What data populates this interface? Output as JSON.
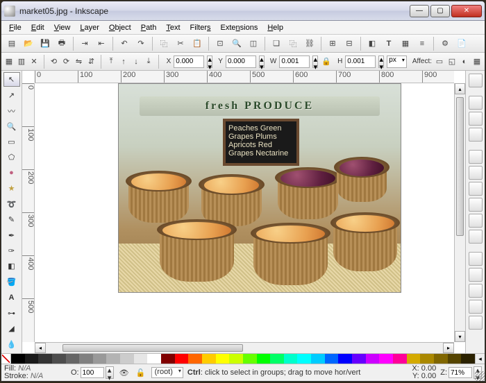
{
  "title": "market05.jpg - Inkscape",
  "menu": {
    "file": "File",
    "edit": "Edit",
    "view": "View",
    "layer": "Layer",
    "object": "Object",
    "path": "Path",
    "text": "Text",
    "filters": "Filters",
    "extensions": "Extensions",
    "help": "Help"
  },
  "coords": {
    "xlabel": "X",
    "x": "0.000",
    "ylabel": "Y",
    "y": "0.000",
    "wlabel": "W",
    "w": "0.001",
    "hlabel": "H",
    "h": "0.001",
    "unit": "px",
    "affect": "Affect:"
  },
  "ruler": {
    "h": [
      "0",
      "100",
      "200",
      "300",
      "400",
      "500",
      "600",
      "700",
      "800",
      "900"
    ],
    "v": [
      "0",
      "100",
      "200",
      "300",
      "400",
      "500"
    ]
  },
  "image": {
    "sign": "fresh PRODUCE",
    "chalk1": "Peaches  Green Grapes  Plums",
    "chalk2": "Apricots  Red Grapes  Nectarine"
  },
  "swatches": [
    "#000000",
    "#1a1a1a",
    "#333333",
    "#4d4d4d",
    "#666666",
    "#808080",
    "#999999",
    "#b3b3b3",
    "#cccccc",
    "#e6e6e6",
    "#ffffff",
    "#800000",
    "#ff0000",
    "#ff6600",
    "#ffcc00",
    "#ffff00",
    "#ccff00",
    "#66ff00",
    "#00ff00",
    "#00ff66",
    "#00ffcc",
    "#00ffff",
    "#00ccff",
    "#0066ff",
    "#0000ff",
    "#6600ff",
    "#cc00ff",
    "#ff00ff",
    "#ff0099",
    "#d4aa00",
    "#aa8800",
    "#806600",
    "#554400",
    "#2b2200"
  ],
  "status": {
    "fill_label": "Fill:",
    "fill_val": "N/A",
    "stroke_label": "Stroke:",
    "stroke_val": "N/A",
    "o_label": "O:",
    "o_val": "100",
    "layer": "(root)",
    "hint_bold": "Ctrl",
    "hint_rest": ": click to select in groups; drag to move hor/vert",
    "x_lbl": "X:",
    "x": "0.00",
    "y_lbl": "Y:",
    "y": "0.00",
    "z_lbl": "Z:",
    "z": "71%"
  }
}
